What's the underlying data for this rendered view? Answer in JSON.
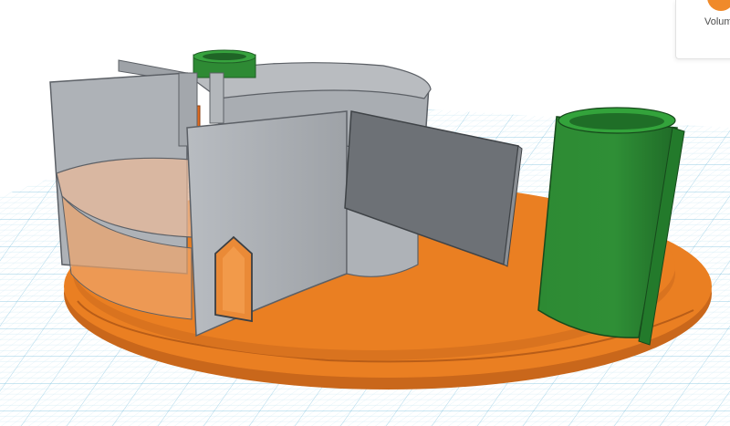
{
  "panel": {
    "volume_label": "Volum",
    "icon": "volume-icon"
  },
  "colors": {
    "grid_background": "#f4fbfe",
    "grid_line": "#a9d7ea",
    "grid_line_major": "#8ac9e3",
    "base_plate": "#ea7f22",
    "base_plate_dark": "#c4651a",
    "wall_gray": "#a3a7ac",
    "wall_gray_dark": "#6d7176",
    "cylinder_green": "#2f8a35",
    "cylinder_green_dark": "#1f6426",
    "peg_orange": "#e06a1f"
  }
}
